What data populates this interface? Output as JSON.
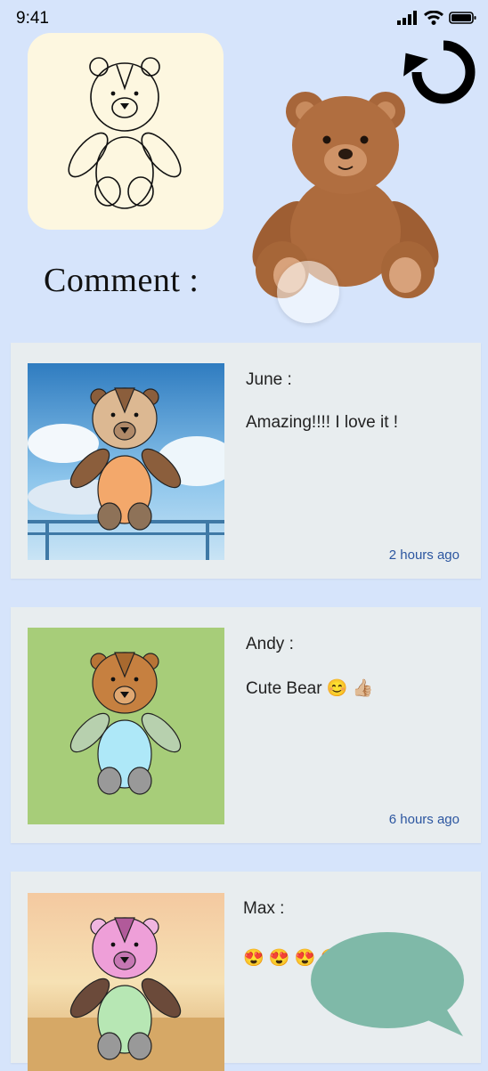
{
  "status_bar": {
    "time": "9:41",
    "icons": [
      "signal-icon",
      "wifi-icon",
      "battery-icon"
    ]
  },
  "header": {
    "refresh_icon": "refresh-icon",
    "comment_heading": "Comment :"
  },
  "comments": [
    {
      "author": "June :",
      "text": "Amazing!!!! I love it !",
      "time": "2 hours ago"
    },
    {
      "author": "Andy :",
      "text": "Cute Bear 😊 👍🏼",
      "time": "6 hours ago"
    },
    {
      "author": "Max :",
      "text": "😍 😍 😍 😍",
      "time": ""
    }
  ],
  "colors": {
    "background": "#d6e4fb",
    "card": "#e8edef",
    "time_text": "#2c56a0",
    "chat_bubble": "#7fb9a8"
  }
}
